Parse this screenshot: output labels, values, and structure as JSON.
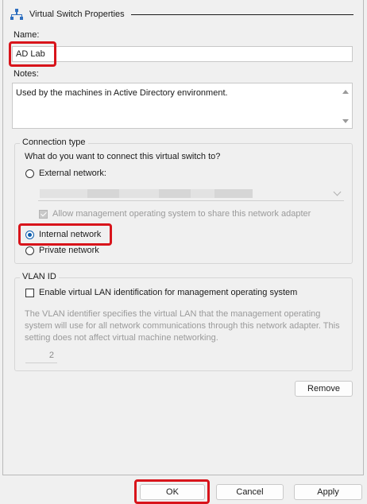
{
  "header": {
    "title": "Virtual Switch Properties",
    "icon": "network-icon"
  },
  "name": {
    "label": "Name:",
    "value": "AD Lab"
  },
  "notes": {
    "label": "Notes:",
    "value": "Used by the machines in Active Directory environment."
  },
  "connection": {
    "title": "Connection type",
    "question": "What do you want to connect this virtual switch to?",
    "options": [
      {
        "label": "External network:",
        "selected": false
      },
      {
        "label": "Internal network",
        "selected": true
      },
      {
        "label": "Private network",
        "selected": false
      }
    ],
    "allow_management_label": "Allow management operating system to share this network adapter",
    "allow_management_checked": true
  },
  "vlan": {
    "title": "VLAN ID",
    "enable_label": "Enable virtual LAN identification for management operating system",
    "enable_checked": false,
    "description": "The VLAN identifier specifies the virtual LAN that the management operating system will use for all network communications through this network adapter. This setting does not affect virtual machine networking.",
    "value": "2"
  },
  "buttons": {
    "remove": "Remove",
    "ok": "OK",
    "cancel": "Cancel",
    "apply": "Apply"
  },
  "colors": {
    "highlight": "#d8141b",
    "radio_accent": "#0b5cad",
    "background": "#f0f0f0"
  }
}
